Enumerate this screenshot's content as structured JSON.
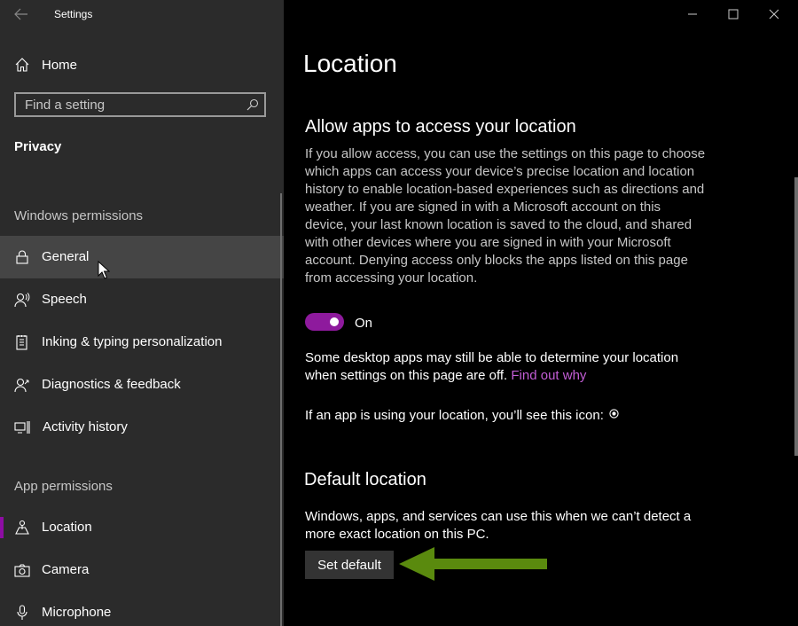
{
  "app": {
    "title": "Settings"
  },
  "sidebar": {
    "home_label": "Home",
    "search": {
      "placeholder": "Find a setting"
    },
    "section": "Privacy",
    "windows_permissions": {
      "header": "Windows permissions",
      "items": [
        {
          "label": "General",
          "icon": "lock-icon"
        },
        {
          "label": "Speech",
          "icon": "speech-icon"
        },
        {
          "label": "Inking & typing personalization",
          "icon": "inking-icon"
        },
        {
          "label": "Diagnostics & feedback",
          "icon": "diagnostics-icon"
        },
        {
          "label": "Activity history",
          "icon": "activity-icon"
        }
      ]
    },
    "app_permissions": {
      "header": "App permissions",
      "items": [
        {
          "label": "Location",
          "icon": "location-icon"
        },
        {
          "label": "Camera",
          "icon": "camera-icon"
        },
        {
          "label": "Microphone",
          "icon": "microphone-icon"
        }
      ]
    }
  },
  "main": {
    "title": "Location",
    "allow_heading": "Allow apps to access your location",
    "allow_description": "If you allow access, you can use the settings on this page to choose which apps can access your device’s precise location and location history to enable location-based experiences such as directions and weather. If you are signed in with a Microsoft account on this device, your last known location is saved to the cloud, and shared with other devices where you are signed in with your Microsoft account. Denying access only blocks the apps listed on this page from accessing your location.",
    "toggle": {
      "state": "On",
      "on": true
    },
    "desktop_note": "Some desktop apps may still be able to determine your location when settings on this page are off.",
    "find_out_link": "Find out why",
    "icon_note": "If an app is using your location, you’ll see this icon:",
    "default_heading": "Default location",
    "default_description": "Windows, apps, and services can use this when we can’t detect a more exact location on this PC.",
    "set_default_button": "Set default"
  },
  "colors": {
    "accent": "#8e0da4",
    "link": "#c35ed6",
    "annotation_arrow": "#5a8a0e",
    "sidebar_bg": "#2b2b2b",
    "main_bg": "#000000"
  }
}
